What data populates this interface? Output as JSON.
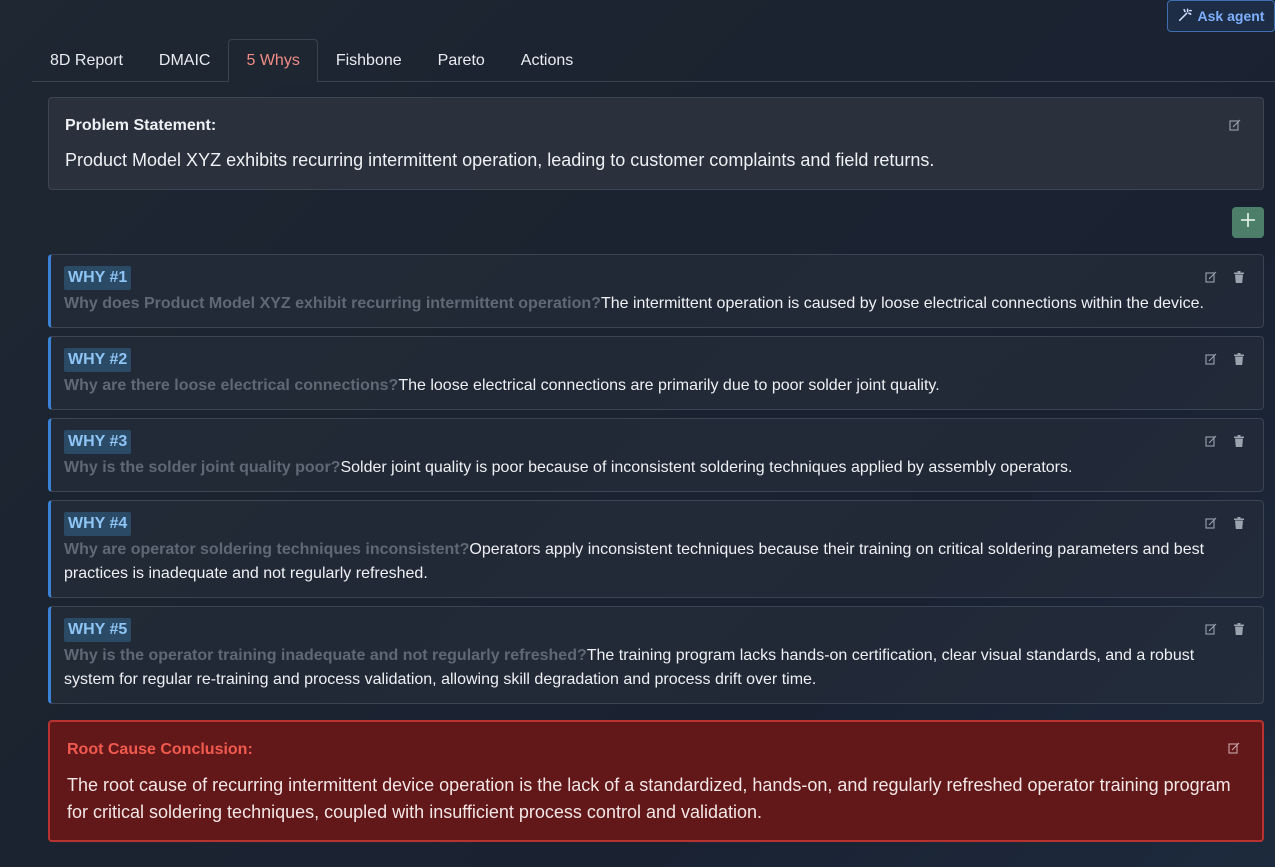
{
  "header": {
    "ask_agent_label": "Ask agent"
  },
  "tabs": [
    {
      "label": "8D Report",
      "active": false
    },
    {
      "label": "DMAIC",
      "active": false
    },
    {
      "label": "5 Whys",
      "active": true
    },
    {
      "label": "Fishbone",
      "active": false
    },
    {
      "label": "Pareto",
      "active": false
    },
    {
      "label": "Actions",
      "active": false
    }
  ],
  "problem": {
    "label": "Problem Statement:",
    "text": "Product Model XYZ exhibits recurring intermittent operation, leading to customer complaints and field returns."
  },
  "whys": [
    {
      "badge": "WHY #1",
      "question": "Why does Product Model XYZ exhibit recurring intermittent operation?",
      "answer": "The intermittent operation is caused by loose electrical connections within the device."
    },
    {
      "badge": "WHY #2",
      "question": "Why are there loose electrical connections?",
      "answer": "The loose electrical connections are primarily due to poor solder joint quality."
    },
    {
      "badge": "WHY #3",
      "question": "Why is the solder joint quality poor?",
      "answer": "Solder joint quality is poor because of inconsistent soldering techniques applied by assembly operators."
    },
    {
      "badge": "WHY #4",
      "question": "Why are operator soldering techniques inconsistent?",
      "answer": "Operators apply inconsistent techniques because their training on critical soldering parameters and best practices is inadequate and not regularly refreshed."
    },
    {
      "badge": "WHY #5",
      "question": "Why is the operator training inadequate and not regularly refreshed?",
      "answer": "The training program lacks hands-on certification, clear visual standards, and a robust system for regular re-training and process validation, allowing skill degradation and process drift over time."
    }
  ],
  "root_cause": {
    "label": "Root Cause Conclusion:",
    "text": "The root cause of recurring intermittent device operation is the lack of a standardized, hands-on, and regularly refreshed operator training program for critical soldering techniques, coupled with insufficient process control and validation."
  },
  "colors": {
    "accent_tab": "#f08c84",
    "why_border": "#3b82d6",
    "add_button": "#4c7e6a",
    "root_bg": "#621719",
    "root_label": "#f25a4f"
  }
}
